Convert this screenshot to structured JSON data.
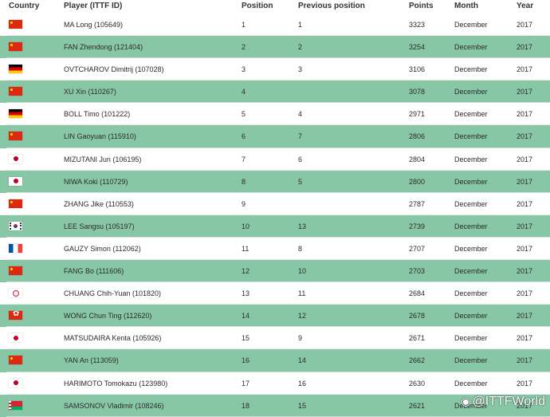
{
  "columns": {
    "country": "Country",
    "player": "Player (ITTF ID)",
    "position": "Position",
    "previous": "Previous position",
    "points": "Points",
    "month": "Month",
    "year": "Year"
  },
  "rows": [
    {
      "flag": "cn",
      "player": "MA Long (105649)",
      "position": "1",
      "previous": "1",
      "points": "3323",
      "month": "December",
      "year": "2017"
    },
    {
      "flag": "cn",
      "player": "FAN Zhendong (121404)",
      "position": "2",
      "previous": "2",
      "points": "3254",
      "month": "December",
      "year": "2017"
    },
    {
      "flag": "de",
      "player": "OVTCHAROV Dimitrij (107028)",
      "position": "3",
      "previous": "3",
      "points": "3106",
      "month": "December",
      "year": "2017"
    },
    {
      "flag": "cn",
      "player": "XU Xin (110267)",
      "position": "4",
      "previous": "",
      "points": "3078",
      "month": "December",
      "year": "2017"
    },
    {
      "flag": "de",
      "player": "BOLL Timo (101222)",
      "position": "5",
      "previous": "4",
      "points": "2971",
      "month": "December",
      "year": "2017"
    },
    {
      "flag": "cn",
      "player": "LIN Gaoyuan (115910)",
      "position": "6",
      "previous": "7",
      "points": "2806",
      "month": "December",
      "year": "2017"
    },
    {
      "flag": "jp",
      "player": "MIZUTANI Jun (106195)",
      "position": "7",
      "previous": "6",
      "points": "2804",
      "month": "December",
      "year": "2017"
    },
    {
      "flag": "jp",
      "player": "NIWA Koki (110729)",
      "position": "8",
      "previous": "5",
      "points": "2800",
      "month": "December",
      "year": "2017"
    },
    {
      "flag": "cn",
      "player": "ZHANG Jike (110553)",
      "position": "9",
      "previous": "",
      "points": "2787",
      "month": "December",
      "year": "2017"
    },
    {
      "flag": "kr",
      "player": "LEE Sangsu (105197)",
      "position": "10",
      "previous": "13",
      "points": "2739",
      "month": "December",
      "year": "2017"
    },
    {
      "flag": "fr",
      "player": "GAUZY Simon (112062)",
      "position": "11",
      "previous": "8",
      "points": "2707",
      "month": "December",
      "year": "2017"
    },
    {
      "flag": "cn",
      "player": "FANG Bo (111606)",
      "position": "12",
      "previous": "10",
      "points": "2703",
      "month": "December",
      "year": "2017"
    },
    {
      "flag": "tpe",
      "player": "CHUANG Chih-Yuan (101820)",
      "position": "13",
      "previous": "11",
      "points": "2684",
      "month": "December",
      "year": "2017"
    },
    {
      "flag": "hk",
      "player": "WONG Chun Ting (112620)",
      "position": "14",
      "previous": "12",
      "points": "2678",
      "month": "December",
      "year": "2017"
    },
    {
      "flag": "jp",
      "player": "MATSUDAIRA Kenta (105926)",
      "position": "15",
      "previous": "9",
      "points": "2671",
      "month": "December",
      "year": "2017"
    },
    {
      "flag": "cn",
      "player": "YAN An (113059)",
      "position": "16",
      "previous": "14",
      "points": "2662",
      "month": "December",
      "year": "2017"
    },
    {
      "flag": "jp",
      "player": "HARIMOTO Tomokazu (123980)",
      "position": "17",
      "previous": "16",
      "points": "2630",
      "month": "December",
      "year": "2017"
    },
    {
      "flag": "blr",
      "player": "SAMSONOV Vladimir (108246)",
      "position": "18",
      "previous": "15",
      "points": "2621",
      "month": "December",
      "year": "2017"
    }
  ],
  "watermark": "@ITTFWorld",
  "colors": {
    "row_alt": "#88c7a6",
    "row": "#ffffff"
  }
}
